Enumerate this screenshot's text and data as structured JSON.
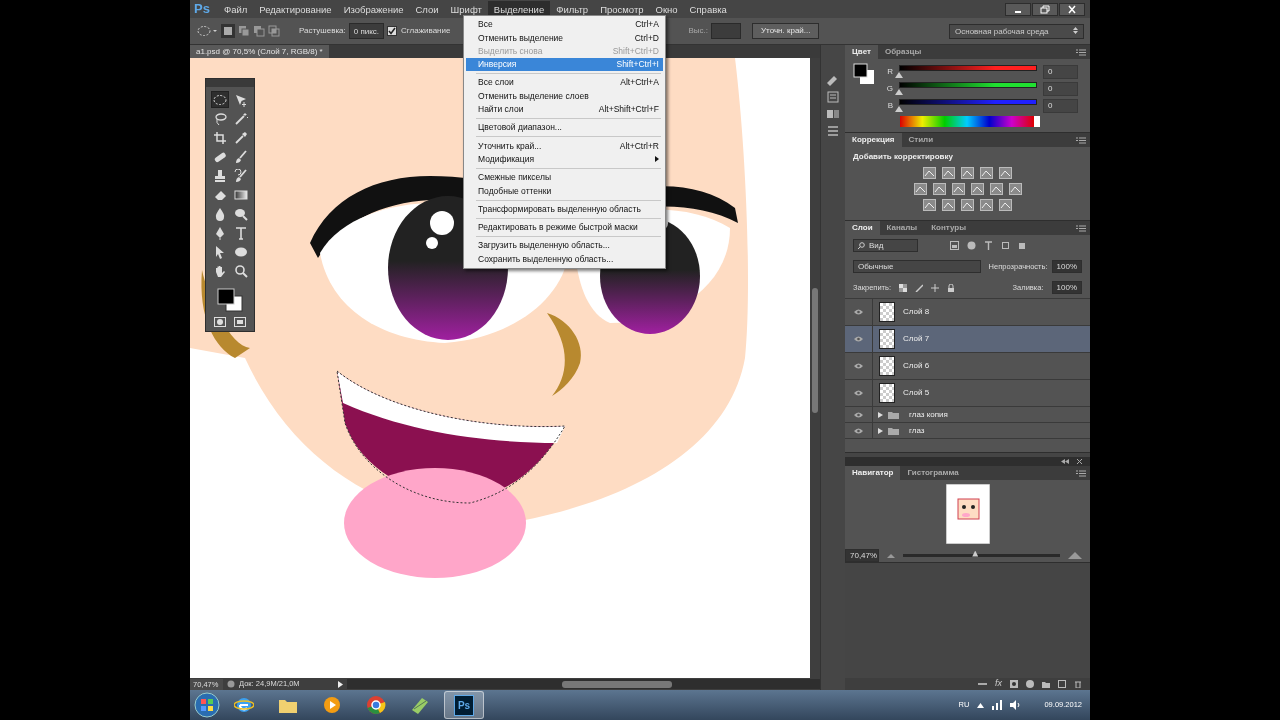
{
  "app": {
    "logo": "Ps"
  },
  "menu": [
    {
      "label": "Файл",
      "selected": false
    },
    {
      "label": "Редактирование",
      "selected": false
    },
    {
      "label": "Изображение",
      "selected": false
    },
    {
      "label": "Слои",
      "selected": false
    },
    {
      "label": "Шрифт",
      "selected": false
    },
    {
      "label": "Выделение",
      "selected": true
    },
    {
      "label": "Фильтр",
      "selected": false
    },
    {
      "label": "Просмотр",
      "selected": false
    },
    {
      "label": "Окно",
      "selected": false
    },
    {
      "label": "Справка",
      "selected": false
    }
  ],
  "options_bar": {
    "feather_label": "Растушевка:",
    "feather_value": "0 пикс.",
    "antialias": {
      "label": "Сглаживание",
      "checked": true
    },
    "height_label": "Выс.:",
    "refine_button": "Уточн. край...",
    "workspace": "Основная рабочая среда"
  },
  "document_tab": "a1.psd @ 70,5% (Слой 7, RGB/8) *",
  "tools": [
    {
      "kind": "ellipse-marquee",
      "selected": true
    },
    {
      "kind": "move",
      "selected": false
    },
    {
      "kind": "lasso",
      "selected": false
    },
    {
      "kind": "wand",
      "selected": false
    },
    {
      "kind": "crop",
      "selected": false
    },
    {
      "kind": "eyedropper",
      "selected": false
    },
    {
      "kind": "healing",
      "selected": false
    },
    {
      "kind": "brush",
      "selected": false
    },
    {
      "kind": "stamp",
      "selected": false
    },
    {
      "kind": "history",
      "selected": false
    },
    {
      "kind": "eraser",
      "selected": false
    },
    {
      "kind": "gradient",
      "selected": false
    },
    {
      "kind": "blur",
      "selected": false
    },
    {
      "kind": "dodge",
      "selected": false
    },
    {
      "kind": "pen",
      "selected": false
    },
    {
      "kind": "type",
      "selected": false
    },
    {
      "kind": "path-select",
      "selected": false
    },
    {
      "kind": "ellipse",
      "selected": false
    },
    {
      "kind": "hand",
      "selected": false
    },
    {
      "kind": "zoom",
      "selected": false
    }
  ],
  "dropdown": {
    "groups": [
      [
        {
          "label": "Все",
          "shortcut": "Ctrl+A",
          "disabled": false,
          "selected": false,
          "submenu": false
        },
        {
          "label": "Отменить выделение",
          "shortcut": "Ctrl+D",
          "disabled": false,
          "selected": false,
          "submenu": false
        },
        {
          "label": "Выделить снова",
          "shortcut": "Shift+Ctrl+D",
          "disabled": true,
          "selected": false,
          "submenu": false
        },
        {
          "label": "Инверсия",
          "shortcut": "Shift+Ctrl+I",
          "disabled": false,
          "selected": true,
          "submenu": false
        }
      ],
      [
        {
          "label": "Все слои",
          "shortcut": "Alt+Ctrl+A",
          "disabled": false,
          "selected": false,
          "submenu": false
        },
        {
          "label": "Отменить выделение слоев",
          "disabled": false,
          "selected": false,
          "submenu": false
        },
        {
          "label": "Найти слои",
          "shortcut": "Alt+Shift+Ctrl+F",
          "disabled": false,
          "selected": false,
          "submenu": false
        }
      ],
      [
        {
          "label": "Цветовой диапазон...",
          "disabled": false,
          "selected": false,
          "submenu": false
        }
      ],
      [
        {
          "label": "Уточнить край...",
          "shortcut": "Alt+Ctrl+R",
          "disabled": false,
          "selected": false,
          "submenu": false
        },
        {
          "label": "Модификация",
          "disabled": false,
          "selected": false,
          "submenu": true
        }
      ],
      [
        {
          "label": "Смежные пикселы",
          "disabled": false,
          "selected": false,
          "submenu": false
        },
        {
          "label": "Подобные оттенки",
          "disabled": false,
          "selected": false,
          "submenu": false
        }
      ],
      [
        {
          "label": "Трансформировать выделенную область",
          "disabled": false,
          "selected": false,
          "submenu": false
        }
      ],
      [
        {
          "label": "Редактировать в режиме быстрой маски",
          "disabled": false,
          "selected": false,
          "submenu": false
        }
      ],
      [
        {
          "label": "Загрузить выделенную область...",
          "disabled": false,
          "selected": false,
          "submenu": false
        },
        {
          "label": "Сохранить выделенную область...",
          "disabled": false,
          "selected": false,
          "submenu": false
        }
      ]
    ]
  },
  "color_panel": {
    "tabs": [
      {
        "label": "Цвет",
        "selected": true
      },
      {
        "label": "Образцы",
        "selected": false
      }
    ],
    "channels": [
      {
        "name": "R",
        "value": "0",
        "color": "#ff2020",
        "level": 0
      },
      {
        "name": "G",
        "value": "0",
        "color": "#20e030",
        "level": 0
      },
      {
        "name": "B",
        "value": "0",
        "color": "#2020ff",
        "level": 0
      }
    ]
  },
  "adjustments_panel": {
    "tabs": [
      {
        "label": "Коррекция",
        "selected": true
      },
      {
        "label": "Стили",
        "selected": false
      }
    ],
    "heading": "Добавить корректировку"
  },
  "layers_panel": {
    "tabs": [
      {
        "label": "Слои",
        "selected": true
      },
      {
        "label": "Каналы",
        "selected": false
      },
      {
        "label": "Контуры",
        "selected": false
      }
    ],
    "filter": "Вид",
    "blend_mode": "Обычные",
    "opacity_label": "Непрозрачность:",
    "opacity": "100%",
    "lock_label": "Закрепить:",
    "fill_label": "Заливка:",
    "fill": "100%",
    "layers": [
      {
        "name": "Слой 8",
        "kind": "layer",
        "visible": true,
        "selected": false
      },
      {
        "name": "Слой 7",
        "kind": "layer",
        "visible": true,
        "selected": true
      },
      {
        "name": "Слой 6",
        "kind": "layer",
        "visible": true,
        "selected": false
      },
      {
        "name": "Слой 5",
        "kind": "layer",
        "visible": true,
        "selected": false
      },
      {
        "name": "глаз копия",
        "kind": "group",
        "visible": true,
        "selected": false
      },
      {
        "name": "глаз",
        "kind": "group",
        "visible": true,
        "selected": false
      }
    ],
    "effects_button": "fx"
  },
  "navigator_panel": {
    "tabs": [
      {
        "label": "Навигатор",
        "selected": true
      },
      {
        "label": "Гистограмма",
        "selected": false
      }
    ],
    "zoom": "70,47%",
    "level": 0.46
  },
  "status_bar": {
    "zoom": "70,47%",
    "doc_size": "Док: 24,9M/21,0M"
  },
  "taskbar": {
    "apps": [
      {
        "kind": "ie",
        "selected": false
      },
      {
        "kind": "folder",
        "selected": false
      },
      {
        "kind": "media",
        "selected": false
      },
      {
        "kind": "chrome",
        "selected": false
      },
      {
        "kind": "notes",
        "selected": false
      },
      {
        "kind": "photoshop",
        "label": "Ps",
        "selected": true
      }
    ],
    "language": "RU",
    "date": "09.09.2012"
  }
}
